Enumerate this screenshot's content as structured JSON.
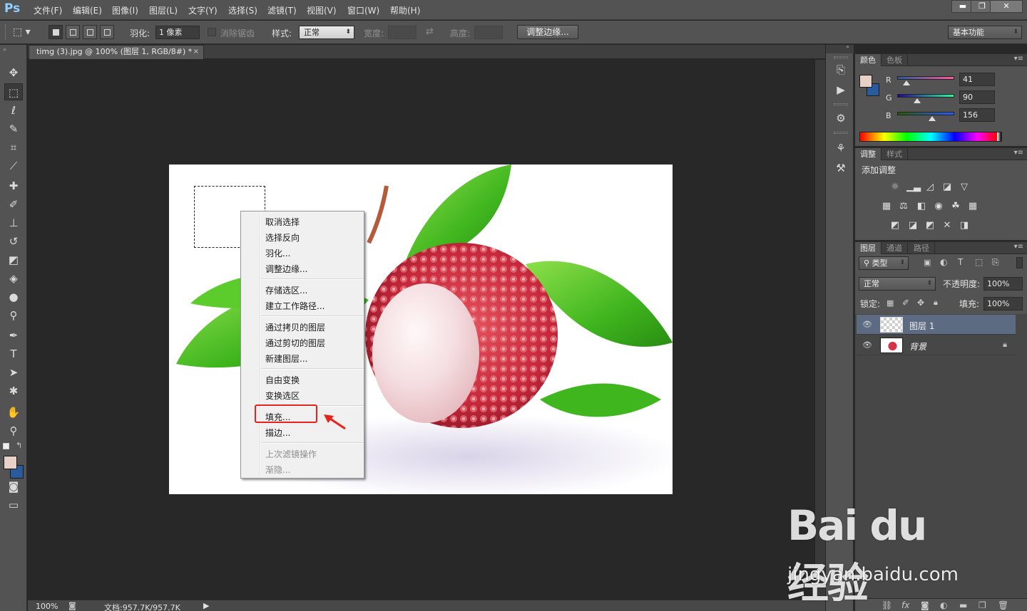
{
  "app": {
    "logo": "Ps"
  },
  "menubar": {
    "items": [
      "文件(F)",
      "编辑(E)",
      "图像(I)",
      "图层(L)",
      "文字(Y)",
      "选择(S)",
      "滤镜(T)",
      "视图(V)",
      "窗口(W)",
      "帮助(H)"
    ],
    "window_controls": {
      "minimize": "▬",
      "restore": "❐",
      "close": "✕"
    }
  },
  "options": {
    "feather_label": "羽化:",
    "feather_value": "1 像素",
    "antialias_label": "消除锯齿",
    "style_label": "样式:",
    "style_value": "正常",
    "width_label": "宽度:",
    "height_label": "高度:",
    "refine_edge_button": "调整边缘...",
    "workspace_value": "基本功能"
  },
  "document": {
    "tab_title": "timg (3).jpg @ 100% (图层 1, RGB/8#) *",
    "tab_close": "×"
  },
  "context_menu": {
    "items": [
      {
        "label": "取消选择",
        "enabled": true
      },
      {
        "label": "选择反向",
        "enabled": true
      },
      {
        "label": "羽化...",
        "enabled": true
      },
      {
        "label": "调整边缘...",
        "enabled": true
      },
      {
        "label": "存储选区...",
        "enabled": true
      },
      {
        "label": "建立工作路径...",
        "enabled": true
      },
      {
        "label": "通过拷贝的图层",
        "enabled": true
      },
      {
        "label": "通过剪切的图层",
        "enabled": true
      },
      {
        "label": "新建图层...",
        "enabled": true
      },
      {
        "label": "自由变换",
        "enabled": true
      },
      {
        "label": "变换选区",
        "enabled": true
      },
      {
        "label": "填充...",
        "enabled": true,
        "highlighted": true
      },
      {
        "label": "描边...",
        "enabled": true
      },
      {
        "label": "上次滤镜操作",
        "enabled": false
      },
      {
        "label": "渐隐...",
        "enabled": false
      }
    ]
  },
  "statusbar": {
    "zoom": "100%",
    "doc_size": "文档:957.7K/957.7K"
  },
  "color_panel": {
    "tabs": [
      "颜色",
      "色板"
    ],
    "r_label": "R",
    "g_label": "G",
    "b_label": "B",
    "r": 41,
    "g": 90,
    "b": 156,
    "foreground": "#e8d2c7",
    "background": "#295a9c"
  },
  "adjustments_panel": {
    "tabs": [
      "调整",
      "样式"
    ],
    "title": "添加调整"
  },
  "layers_panel": {
    "tabs": [
      "图层",
      "通道",
      "路径"
    ],
    "filter_value": "类型",
    "blend_mode": "正常",
    "opacity_label": "不透明度:",
    "opacity_value": "100%",
    "lock_label": "锁定:",
    "fill_label": "填充:",
    "fill_value": "100%",
    "layers": [
      {
        "name": "图层 1",
        "selected": true,
        "locked": false
      },
      {
        "name": "背景",
        "selected": false,
        "locked": true
      }
    ]
  },
  "watermark": {
    "logo": "Bai du 经验",
    "url": "jingyan.baidu.com"
  }
}
